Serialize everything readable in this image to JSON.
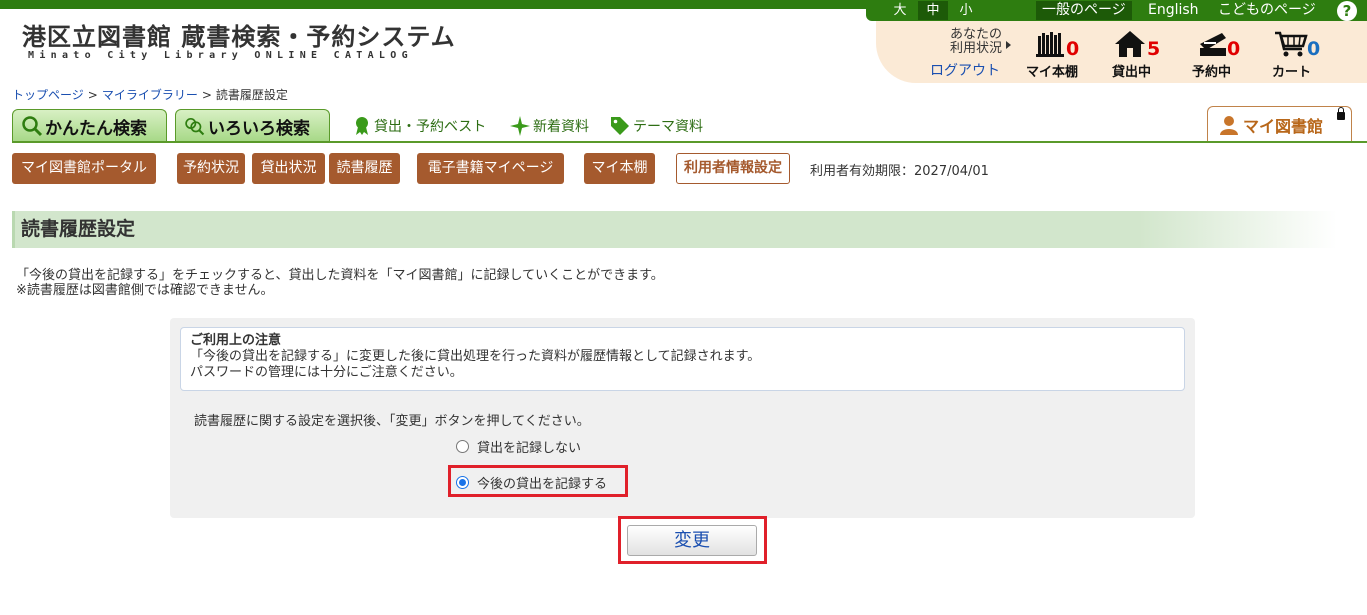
{
  "header": {
    "title": "港区立図書館 蔵書検索・予約システム",
    "subtitle": "Minato City Library ONLINE CATALOG",
    "font_sizes": [
      "大",
      "中",
      "小"
    ],
    "active_font_size": "中",
    "links": [
      "一般のページ",
      "English",
      "こどものページ"
    ],
    "help": "?"
  },
  "status": {
    "label_line1": "あなたの",
    "label_line2": "利用状況",
    "logout": "ログアウト",
    "items": [
      {
        "label": "マイ本棚",
        "count": "0",
        "icon": "bookshelf-icon"
      },
      {
        "label": "貸出中",
        "count": "5",
        "icon": "house-icon"
      },
      {
        "label": "予約中",
        "count": "0",
        "icon": "reservation-icon"
      },
      {
        "label": "カート",
        "count": "0",
        "icon": "cart-icon"
      }
    ]
  },
  "breadcrumb": {
    "items": [
      "トップページ",
      "マイライブラリー",
      "読書履歴設定"
    ],
    "separator": ">"
  },
  "tabs": {
    "simple_search": "かんたん検索",
    "advanced_search": "いろいろ検索",
    "best": "貸出・予約ベスト",
    "new_items": "新着資料",
    "theme": "テーマ資料",
    "my_library": "マイ図書館"
  },
  "subnav": {
    "items": [
      "マイ図書館ポータル",
      "予約状況",
      "貸出状況",
      "読書履歴",
      "電子書籍マイページ",
      "マイ本棚",
      "利用者情報設定"
    ],
    "active": "利用者情報設定",
    "validity": "利用者有効期限：2027/04/01"
  },
  "main": {
    "title": "読書履歴設定",
    "desc_line1": "「今後の貸出を記録する」をチェックすると、貸出した資料を「マイ図書館」に記録していくことができます。",
    "desc_line2": "※読書履歴は図書館側では確認できません。",
    "notice_title": "ご利用上の注意",
    "notice_line1": "「今後の貸出を記録する」に変更した後に貸出処理を行った資料が履歴情報として記録されます。",
    "notice_line2": "パスワードの管理には十分にご注意ください。",
    "instruction": "読書履歴に関する設定を選択後、「変更」ボタンを押してください。",
    "options": [
      "貸出を記録しない",
      "今後の貸出を記録する"
    ],
    "selected_option": "今後の貸出を記録する",
    "change_button": "変更"
  },
  "colors": {
    "brand_green": "#2e7d10",
    "subnav_brown": "#a55a2e",
    "highlight_red": "#e0202a",
    "count_red": "#e00000",
    "count_blue": "#1a6fc0"
  }
}
